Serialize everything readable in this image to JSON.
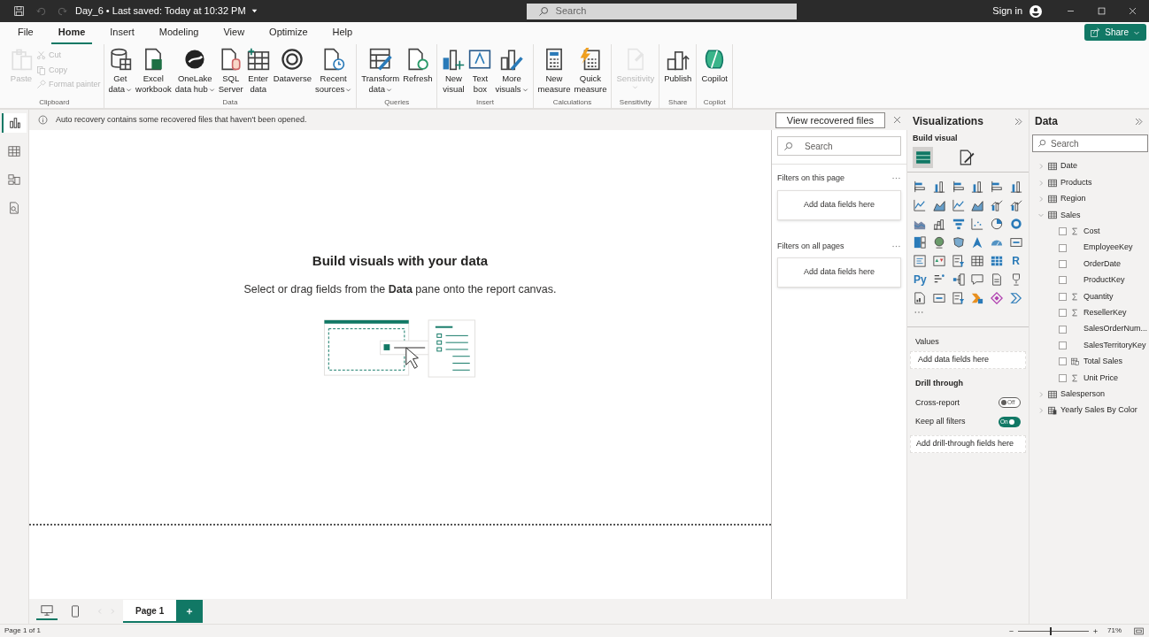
{
  "title_bar": {
    "title": "Day_6 • Last saved: Today at 10:32 PM",
    "search_placeholder": "Search",
    "sign_in": "Sign in"
  },
  "menu_tabs": [
    {
      "label": "File",
      "selected": false
    },
    {
      "label": "Home",
      "selected": true
    },
    {
      "label": "Insert",
      "selected": false
    },
    {
      "label": "Modeling",
      "selected": false
    },
    {
      "label": "View",
      "selected": false
    },
    {
      "label": "Optimize",
      "selected": false
    },
    {
      "label": "Help",
      "selected": false
    }
  ],
  "share_button": "Share",
  "ribbon": [
    {
      "label": "Clipboard",
      "buttons": [
        {
          "kind": "paste",
          "lines": [
            "Paste"
          ],
          "disabled": true,
          "dropdown": false
        }
      ],
      "small_buttons": [
        {
          "kind": "cut",
          "label": "Cut",
          "disabled": true
        },
        {
          "kind": "copy",
          "label": "Copy",
          "disabled": true
        },
        {
          "kind": "painter",
          "label": "Format painter",
          "disabled": true
        }
      ]
    },
    {
      "label": "Data",
      "buttons": [
        {
          "kind": "database",
          "lines": [
            "Get",
            "data"
          ],
          "disabled": false,
          "dropdown": true
        },
        {
          "kind": "excel",
          "lines": [
            "Excel",
            "workbook"
          ],
          "disabled": false,
          "dropdown": false
        },
        {
          "kind": "onelake",
          "lines": [
            "OneLake",
            "data hub"
          ],
          "disabled": false,
          "dropdown": true
        },
        {
          "kind": "sql",
          "lines": [
            "SQL",
            "Server"
          ],
          "disabled": false,
          "dropdown": false
        },
        {
          "kind": "enter",
          "lines": [
            "Enter",
            "data"
          ],
          "disabled": false,
          "dropdown": false
        },
        {
          "kind": "dataverse",
          "lines": [
            "Dataverse"
          ],
          "disabled": false,
          "dropdown": false
        },
        {
          "kind": "recent",
          "lines": [
            "Recent",
            "sources"
          ],
          "disabled": false,
          "dropdown": true
        }
      ]
    },
    {
      "label": "Queries",
      "buttons": [
        {
          "kind": "transform",
          "lines": [
            "Transform",
            "data"
          ],
          "disabled": false,
          "dropdown": true
        },
        {
          "kind": "refresh",
          "lines": [
            "Refresh"
          ],
          "disabled": false,
          "dropdown": false
        }
      ]
    },
    {
      "label": "Insert",
      "buttons": [
        {
          "kind": "newvisual",
          "lines": [
            "New",
            "visual"
          ],
          "disabled": false,
          "dropdown": false
        },
        {
          "kind": "textbox",
          "lines": [
            "Text",
            "box"
          ],
          "disabled": false,
          "dropdown": false
        },
        {
          "kind": "morevisuals",
          "lines": [
            "More",
            "visuals"
          ],
          "disabled": false,
          "dropdown": true
        }
      ]
    },
    {
      "label": "Calculations",
      "buttons": [
        {
          "kind": "newmeasure",
          "lines": [
            "New",
            "measure"
          ],
          "disabled": false,
          "dropdown": false
        },
        {
          "kind": "quickmeasure",
          "lines": [
            "Quick",
            "measure"
          ],
          "disabled": false,
          "dropdown": false
        }
      ]
    },
    {
      "label": "Sensitivity",
      "buttons": [
        {
          "kind": "sensitivity",
          "lines": [
            "Sensitivity"
          ],
          "disabled": true,
          "dropdown": true
        }
      ]
    },
    {
      "label": "Share",
      "buttons": [
        {
          "kind": "publish",
          "lines": [
            "Publish"
          ],
          "disabled": false,
          "dropdown": false
        }
      ]
    },
    {
      "label": "Copilot",
      "buttons": [
        {
          "kind": "copilot",
          "lines": [
            "Copilot"
          ],
          "disabled": false,
          "dropdown": false
        }
      ]
    }
  ],
  "left_rail": [
    {
      "kind": "report",
      "selected": true
    },
    {
      "kind": "table",
      "selected": false
    },
    {
      "kind": "model",
      "selected": false
    },
    {
      "kind": "dax",
      "selected": false
    }
  ],
  "info_bar": {
    "message": "Auto recovery contains some recovered files that haven't been opened.",
    "button": "View recovered files"
  },
  "canvas": {
    "heading": "Build visuals with your data",
    "subtext": "Select or drag fields from the **Data** pane onto the report canvas."
  },
  "filters": {
    "search_placeholder": "Search",
    "sections": [
      {
        "title": "Filters on this page",
        "drop_hint": "Add data fields here"
      },
      {
        "title": "Filters on all pages",
        "drop_hint": "Add data fields here"
      }
    ]
  },
  "visualizations": {
    "title": "Visualizations",
    "subtitle": "Build visual",
    "modes": [
      {
        "kind": "build",
        "selected": true
      },
      {
        "kind": "format",
        "selected": false
      }
    ],
    "types": [
      {
        "kind": "hbar"
      },
      {
        "kind": "vbar"
      },
      {
        "kind": "hbar"
      },
      {
        "kind": "vbar"
      },
      {
        "kind": "hbar"
      },
      {
        "kind": "vbar"
      },
      {
        "kind": "line"
      },
      {
        "kind": "area"
      },
      {
        "kind": "line"
      },
      {
        "kind": "area"
      },
      {
        "kind": "combo"
      },
      {
        "kind": "combo"
      },
      {
        "kind": "ribbon"
      },
      {
        "kind": "waterfall"
      },
      {
        "kind": "funnel"
      },
      {
        "kind": "scatter"
      },
      {
        "kind": "pie"
      },
      {
        "kind": "donut"
      },
      {
        "kind": "treemap"
      },
      {
        "kind": "globe"
      },
      {
        "kind": "map"
      },
      {
        "kind": "navigation"
      },
      {
        "kind": "gauge"
      },
      {
        "kind": "card"
      },
      {
        "kind": "list"
      },
      {
        "kind": "kpi"
      },
      {
        "kind": "slicer"
      },
      {
        "kind": "table"
      },
      {
        "kind": "matrix"
      },
      {
        "kind": "text",
        "label": "R"
      },
      {
        "kind": "text",
        "label": "Py"
      },
      {
        "kind": "influencers"
      },
      {
        "kind": "tree"
      },
      {
        "kind": "speech"
      },
      {
        "kind": "document"
      },
      {
        "kind": "trophy"
      },
      {
        "kind": "report"
      },
      {
        "kind": "card"
      },
      {
        "kind": "slicer"
      },
      {
        "kind": "flow"
      },
      {
        "kind": "diamond"
      },
      {
        "kind": "chevrons"
      }
    ],
    "values_label": "Values",
    "values_hint": "Add data fields here",
    "drill_title": "Drill through",
    "toggles": [
      {
        "label": "Cross-report",
        "on": false,
        "text": "Off"
      },
      {
        "label": "Keep all filters",
        "on": true,
        "text": "On"
      }
    ],
    "drill_hint": "Add drill-through fields here"
  },
  "data": {
    "title": "Data",
    "search_placeholder": "Search",
    "tables": [
      {
        "name": "Date",
        "kind": "table",
        "expanded": false
      },
      {
        "name": "Products",
        "kind": "table",
        "expanded": false
      },
      {
        "name": "Region",
        "kind": "table",
        "expanded": false
      },
      {
        "name": "Sales",
        "kind": "table",
        "expanded": true,
        "children": [
          {
            "name": "Cost",
            "kind": "sum",
            "checked": false
          },
          {
            "name": "EmployeeKey",
            "kind": "plain",
            "checked": false
          },
          {
            "name": "OrderDate",
            "kind": "plain",
            "checked": false
          },
          {
            "name": "ProductKey",
            "kind": "plain",
            "checked": false
          },
          {
            "name": "Quantity",
            "kind": "sum",
            "checked": false
          },
          {
            "name": "ResellerKey",
            "kind": "sum",
            "checked": false
          },
          {
            "name": "SalesOrderNum...",
            "kind": "plain",
            "checked": false
          },
          {
            "name": "SalesTerritoryKey",
            "kind": "plain",
            "checked": false
          },
          {
            "name": "Total Sales",
            "kind": "measure",
            "checked": false
          },
          {
            "name": "Unit Price",
            "kind": "sum",
            "checked": false
          }
        ]
      },
      {
        "name": "Salesperson",
        "kind": "table",
        "expanded": false
      },
      {
        "name": "Yearly Sales By Color",
        "kind": "calculated",
        "expanded": false
      }
    ]
  },
  "page_bar": {
    "views": [
      {
        "kind": "desktop",
        "selected": true
      },
      {
        "kind": "mobile",
        "selected": false
      }
    ],
    "pages": [
      {
        "label": "Page 1",
        "selected": true
      }
    ]
  },
  "status_bar": {
    "page_info": "Page 1 of 1",
    "zoom": {
      "level": 0.45,
      "reading": "71%"
    }
  }
}
